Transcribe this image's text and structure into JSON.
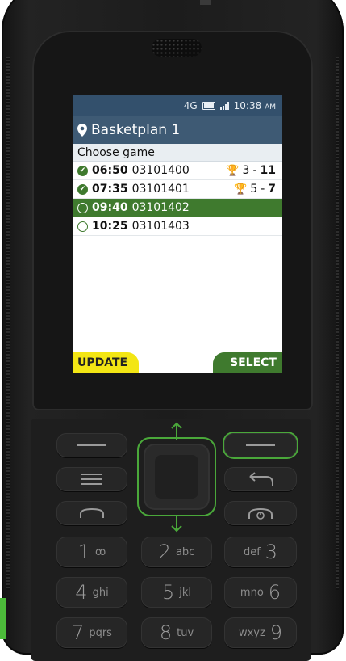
{
  "status": {
    "network": "4G",
    "time": "10:38",
    "ampm": "AM"
  },
  "header": {
    "title": "Basketplan 1"
  },
  "list": {
    "heading": "Choose game",
    "games": [
      {
        "time": "06:50",
        "code": "03101400",
        "done": true,
        "score_home": "3",
        "score_sep": " - ",
        "score_away": "11",
        "winner": "away"
      },
      {
        "time": "07:35",
        "code": "03101401",
        "done": true,
        "score_home": "5",
        "score_sep": " - ",
        "score_away": "7",
        "winner": "away"
      },
      {
        "time": "09:40",
        "code": "03101402",
        "done": false,
        "selected": true
      },
      {
        "time": "10:25",
        "code": "03101403",
        "done": false
      }
    ]
  },
  "softkeys": {
    "left": "UPDATE",
    "right": "SELECT"
  },
  "keypad": {
    "k1": {
      "digit": "1",
      "letters": "ꝏ"
    },
    "k2": {
      "digit": "2",
      "letters": "abc"
    },
    "k3": {
      "digit": "3",
      "letters": "def"
    },
    "k4": {
      "digit": "4",
      "letters": "ghi"
    },
    "k5": {
      "digit": "5",
      "letters": "jkl"
    },
    "k6": {
      "digit": "6",
      "letters": "mno"
    },
    "k7": {
      "digit": "7",
      "letters": "pqrs"
    },
    "k8": {
      "digit": "8",
      "letters": "tuv"
    },
    "k9": {
      "digit": "9",
      "letters": "wxyz"
    }
  },
  "colors": {
    "accent_green": "#3f7a2e",
    "highlight_green": "#4aa83a",
    "header_blue": "#3e5a74",
    "softkey_yellow": "#f3e614",
    "trophy_gold": "#e8b400"
  }
}
